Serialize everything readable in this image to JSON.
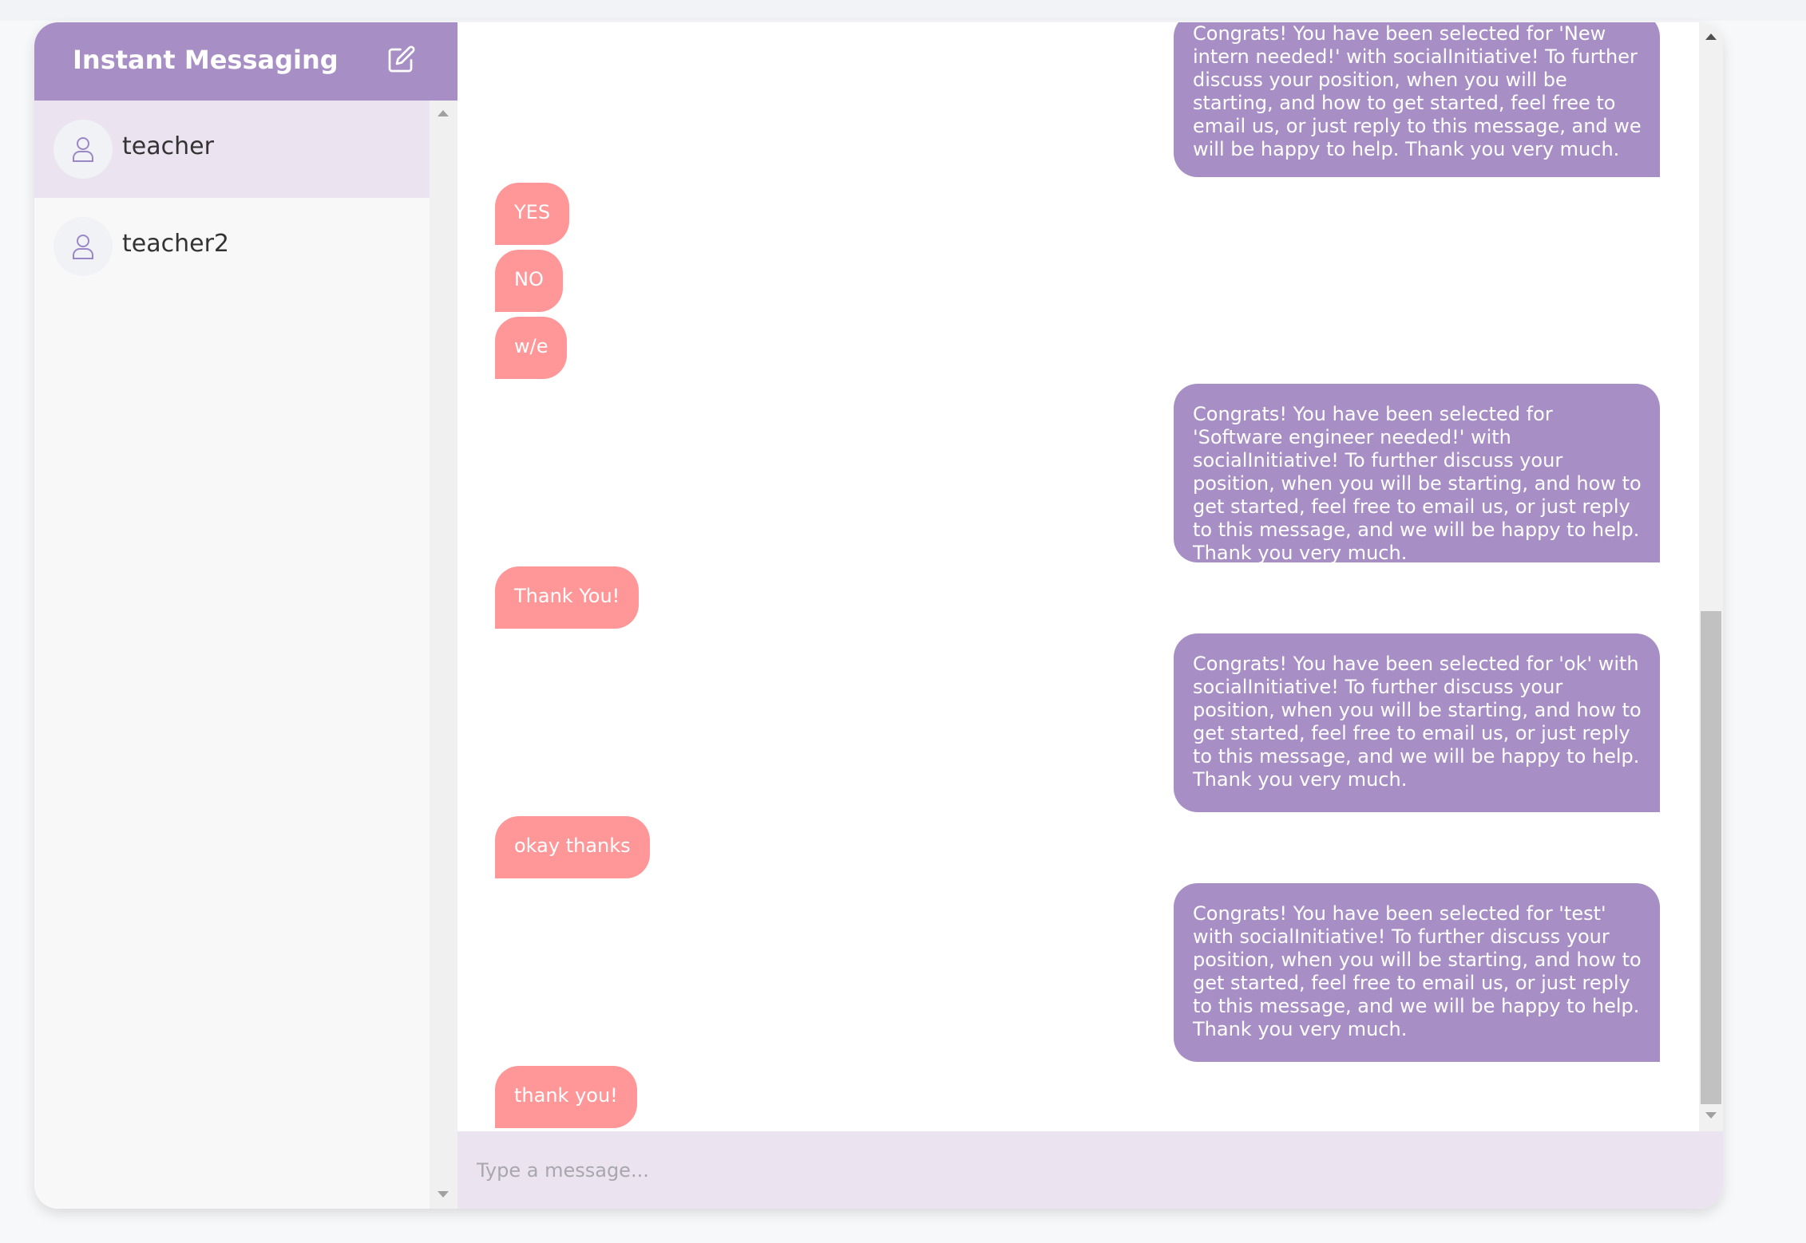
{
  "sidebar": {
    "title": "Instant Messaging",
    "compose_icon": "edit-icon",
    "contacts": [
      {
        "name": "teacher",
        "active": true,
        "icon": "user-icon"
      },
      {
        "name": "teacher2",
        "active": false,
        "icon": "user-icon"
      }
    ]
  },
  "messages": [
    {
      "direction": "out",
      "text": "Congrats! You have been selected for 'New intern needed!' with socialInitiative! To further discuss your position, when you will be starting, and how to get started, feel free to email us, or just reply to this message, and we will be happy to help. Thank you very much."
    },
    {
      "direction": "in",
      "text": "YES"
    },
    {
      "direction": "in",
      "text": "NO"
    },
    {
      "direction": "in",
      "text": "w/e"
    },
    {
      "direction": "out",
      "text": "Congrats! You have been selected for 'Software engineer needed!' with socialInitiative! To further discuss your position, when you will be starting, and how to get started, feel free to email us, or just reply to this message, and we will be happy to help. Thank you very much."
    },
    {
      "direction": "in",
      "text": "Thank You!"
    },
    {
      "direction": "out",
      "text": "Congrats! You have been selected for 'ok' with socialInitiative! To further discuss your position, when you will be starting, and how to get started, feel free to email us, or just reply to this message, and we will be happy to help. Thank you very much."
    },
    {
      "direction": "in",
      "text": "okay thanks"
    },
    {
      "direction": "out",
      "text": "Congrats! You have been selected for 'test' with socialInitiative! To further discuss your position, when you will be starting, and how to get started, feel free to email us, or just reply to this message, and we will be happy to help. Thank you very much."
    },
    {
      "direction": "in",
      "text": "thank you!"
    }
  ],
  "composer": {
    "placeholder": "Type a message...",
    "value": ""
  },
  "colors": {
    "accent": "#a78fc6",
    "incoming": "#ff9799",
    "selected": "#ebe4f0"
  }
}
